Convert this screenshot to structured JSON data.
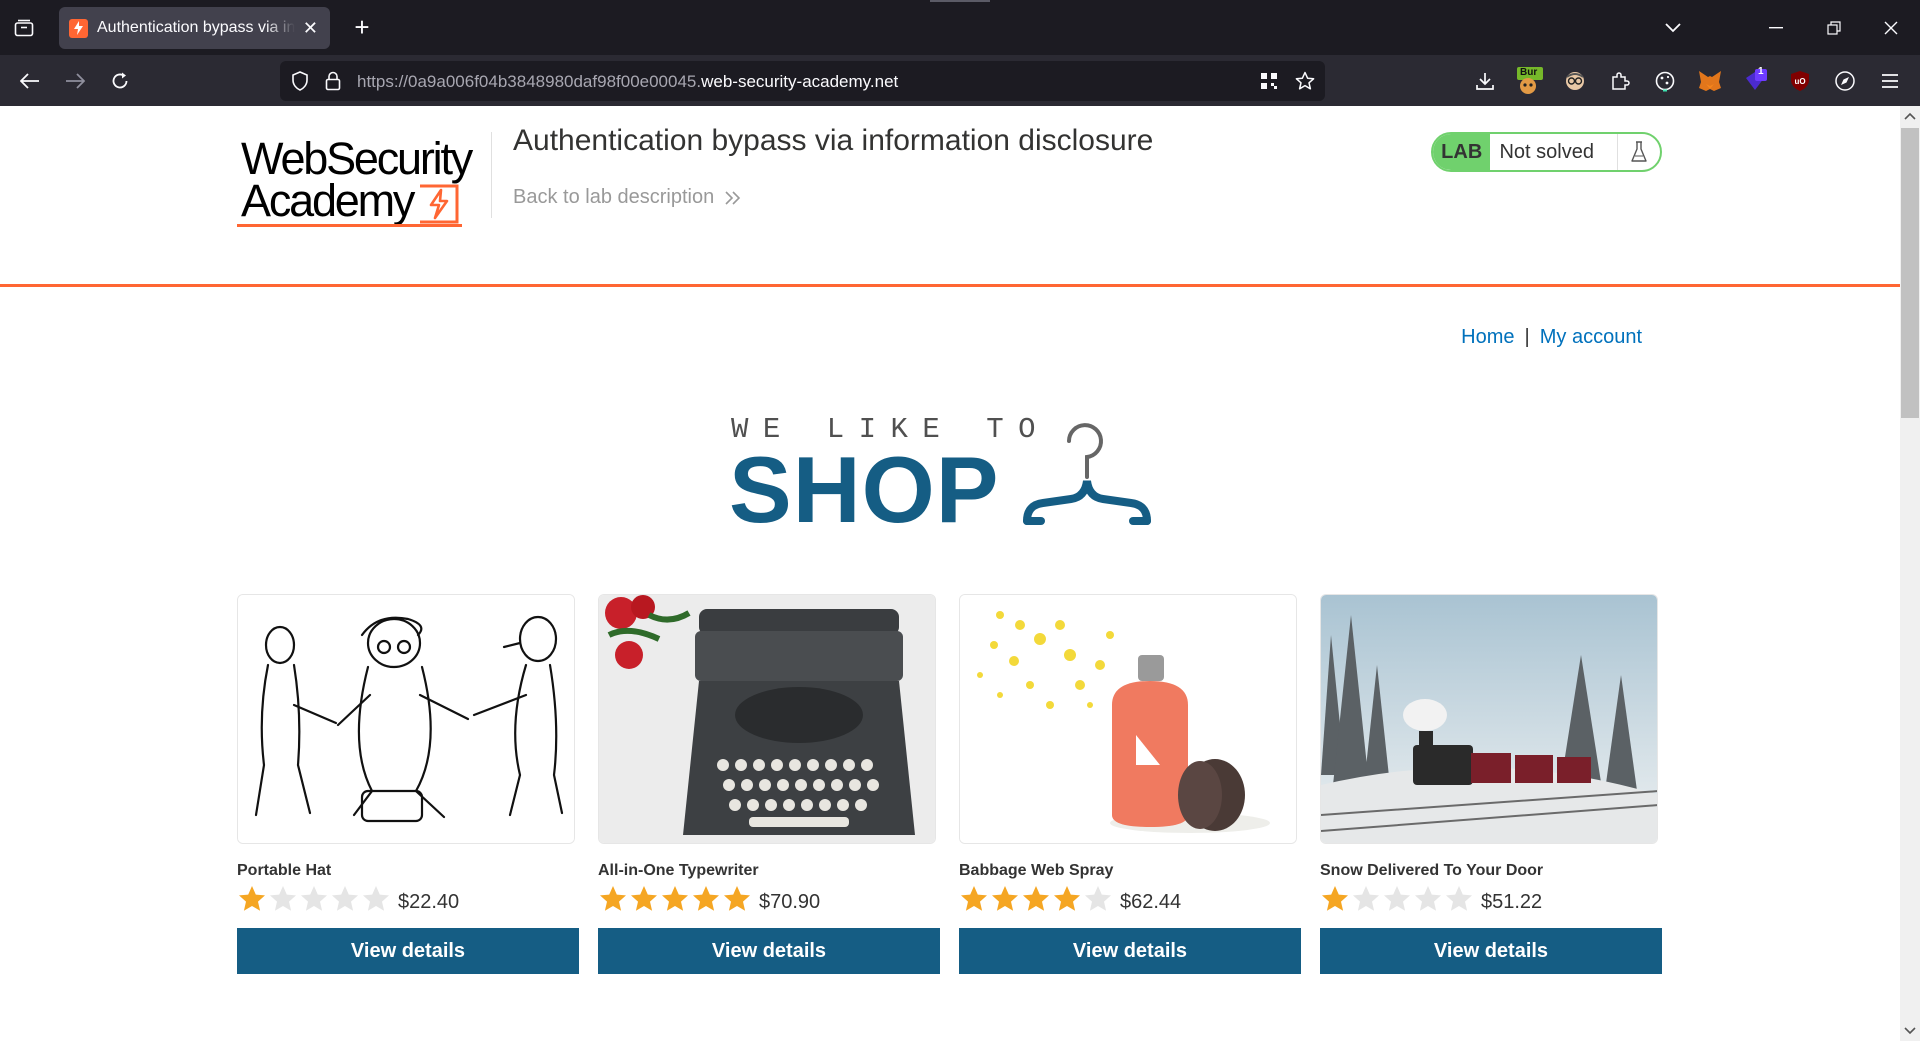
{
  "browser": {
    "tab_title": "Authentication bypass via information disclosure",
    "url_prefix": "https://0a9a006f04b3848980daf98f00e00045.",
    "url_host": "web-security-academy.net",
    "ext_badge_burp": "Bur",
    "ext_badge_count": "1"
  },
  "header": {
    "logo_line1": "WebSecurity",
    "logo_line2": "Academy",
    "lab_title": "Authentication bypass via information disclosure",
    "back_link": "Back to lab description",
    "status_lab": "LAB",
    "status_text": "Not solved"
  },
  "nav": {
    "home": "Home",
    "separator": "|",
    "my_account": "My account"
  },
  "banner": {
    "tagline": "WE LIKE TO",
    "word": "SHOP"
  },
  "products": [
    {
      "name": "Portable Hat",
      "rating": 1,
      "price": "$22.40",
      "button": "View details"
    },
    {
      "name": "All-in-One Typewriter",
      "rating": 5,
      "price": "$70.90",
      "button": "View details"
    },
    {
      "name": "Babbage Web Spray",
      "rating": 4,
      "price": "$62.44",
      "button": "View details"
    },
    {
      "name": "Snow Delivered To Your Door",
      "rating": 1,
      "price": "$51.22",
      "button": "View details"
    }
  ],
  "colors": {
    "accent_orange": "#ff6633",
    "brand_blue": "#155d84",
    "link_blue": "#0071bc",
    "lab_green": "#70d16d",
    "star_gold": "#f5a623"
  }
}
